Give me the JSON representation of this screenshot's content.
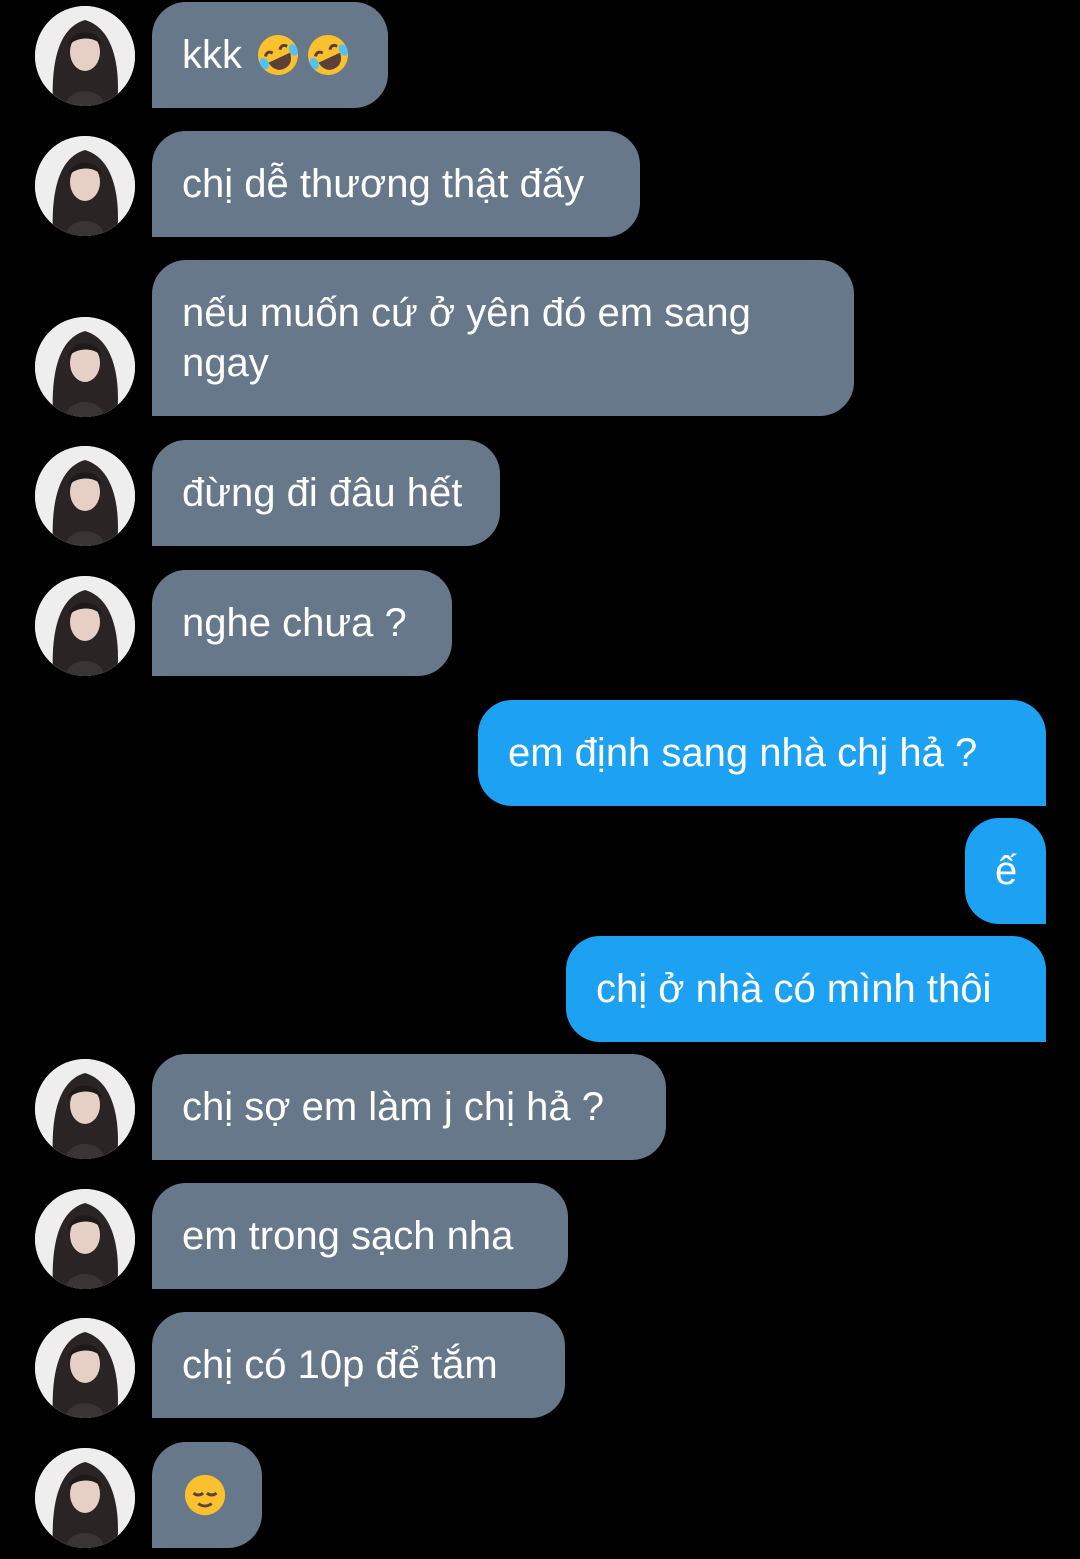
{
  "theme": {
    "background": "#000000",
    "incoming_bubble": "#66788a",
    "outgoing_bubble": "#1da1f2",
    "text": "#ffffff"
  },
  "messages": [
    {
      "side": "in",
      "text": "kkk",
      "emoji": [
        "rolling-on-floor-laughing-icon",
        "rolling-on-floor-laughing-icon"
      ]
    },
    {
      "side": "in",
      "text": "chị dễ thương thật đấy"
    },
    {
      "side": "in",
      "text": "nếu muốn cứ ở yên đó em sang ngay"
    },
    {
      "side": "in",
      "text": "đừng đi đâu hết"
    },
    {
      "side": "in",
      "text": "nghe chưa ?"
    },
    {
      "side": "out",
      "text": "em định sang nhà chj hả ?"
    },
    {
      "side": "out",
      "text": "ế"
    },
    {
      "side": "out",
      "text": "chị ở nhà có mình thôi"
    },
    {
      "side": "in",
      "text": "chị sợ em làm j chị hả ?"
    },
    {
      "side": "in",
      "text": "em trong sạch nha"
    },
    {
      "side": "in",
      "text": "chị có 10p để tắm"
    },
    {
      "side": "in",
      "text": "",
      "emoji": [
        "relieved-face-icon"
      ]
    }
  ]
}
